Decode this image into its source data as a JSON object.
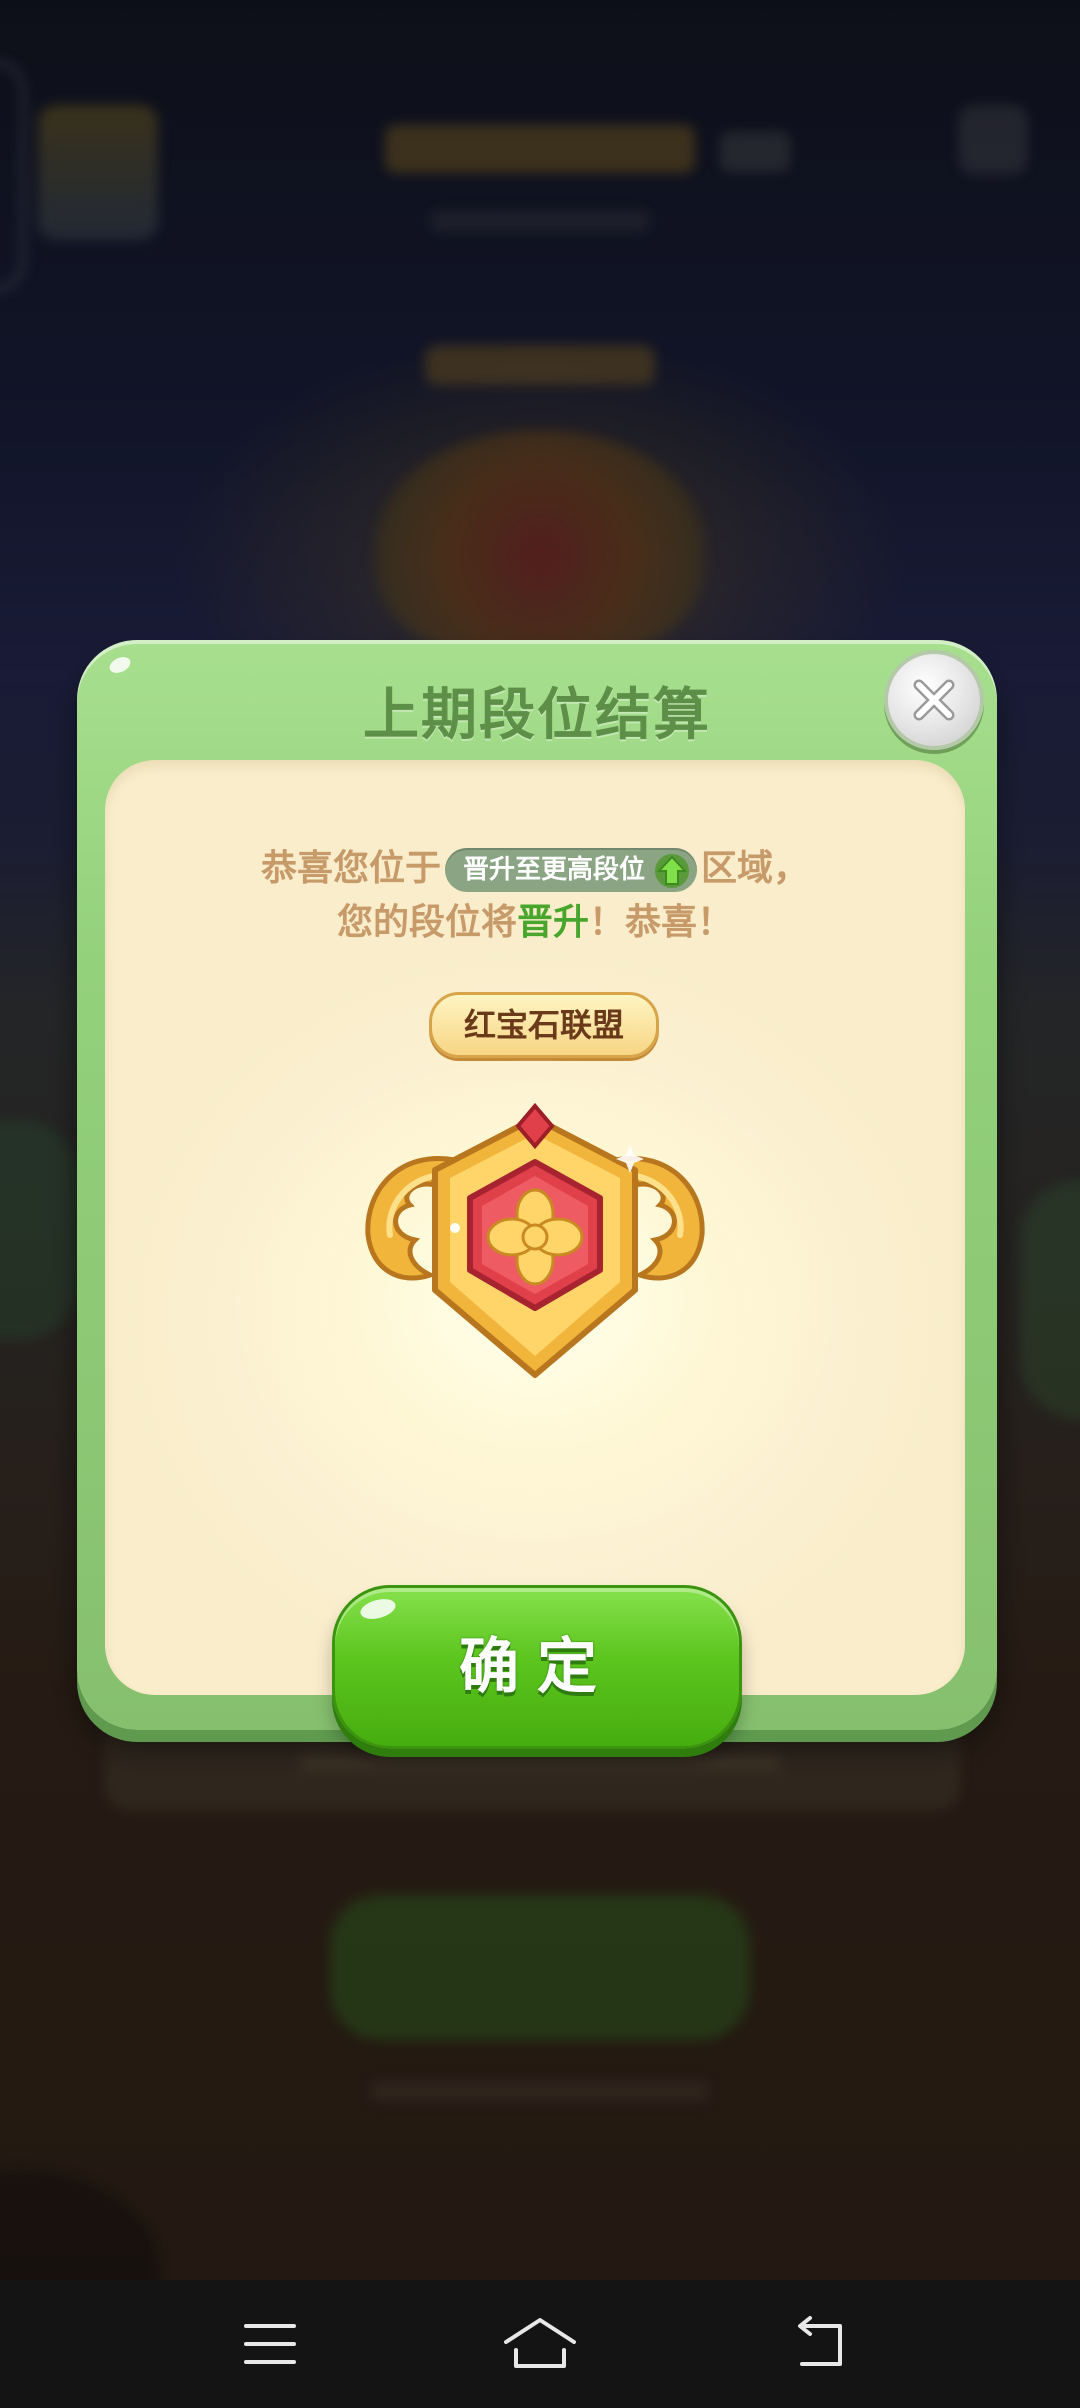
{
  "dialog": {
    "title": "上期段位结算",
    "message_prefix": "恭喜您位于",
    "promotion_chip_label": "晋升至更高段位",
    "message_suffix": "区域，",
    "message_line2_prefix": "您的段位将",
    "message_line2_highlight": "晋升",
    "message_line2_suffix": "！恭喜！",
    "league_name": "红宝石联盟",
    "confirm_label": "确定"
  },
  "icons": {
    "close": "close-icon",
    "promotion": "up-arrow-icon",
    "badge": "ruby-league-badge",
    "nav_menu": "menu-icon",
    "nav_home": "home-icon",
    "nav_back": "back-icon"
  },
  "colors": {
    "dialog_frame": "#94d17b",
    "dialog_title": "#5d8f48",
    "panel_background": "#fdf4d6",
    "message_text": "#c79a6a",
    "highlight_text": "#49a62d",
    "confirm_button": "#5cc51e",
    "badge_gem": "#e0404a",
    "badge_gold": "#f2b53c"
  }
}
